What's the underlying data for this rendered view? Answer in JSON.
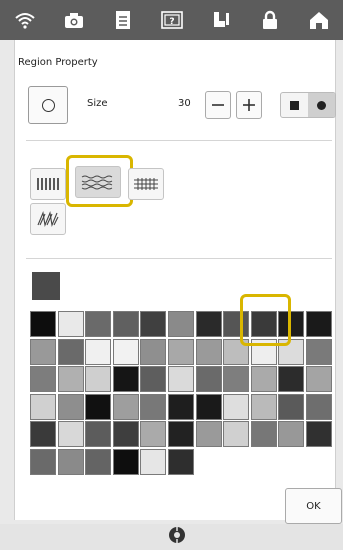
{
  "topbar": {
    "icons": [
      "wifi-icon",
      "camera-icon",
      "document-icon",
      "help-icon",
      "embroidery-foot-icon",
      "lock-icon",
      "home-icon"
    ]
  },
  "dialog": {
    "title": "Region Property",
    "shape_button_icon": "circle-outline-icon",
    "size_label": "Size",
    "size_value": "30",
    "minus_label": "−",
    "plus_label": "+",
    "style_options": [
      "square-dot-icon",
      "round-dot-icon"
    ],
    "selected_style": "round-dot-icon",
    "stitch_types": [
      "fill-stitch-icon",
      "decorative-fill-icon",
      "tatami-stitch-icon",
      "free-stitch-icon"
    ],
    "selected_stitch": "decorative-fill-icon",
    "selected_color": "#4a4a4a",
    "palette": [
      [
        "#0d0d0d",
        "#e9e9e9",
        "#6a6a6a",
        "#606060",
        "#404040",
        "#8a8a8a",
        "#2a2a2a",
        "#555555",
        "#3a3a3a",
        "#1e1e1e",
        "#1a1a1a"
      ],
      [
        "#999999",
        "#6a6a6a",
        "#f0f0f0",
        "#f2f2f2",
        "#8f8f8f",
        "#a8a8a8",
        "#9a9a9a",
        "#bdbdbd",
        "#eeeeee",
        "#dcdcdc",
        "#7a7a7a"
      ],
      [
        "#7d7d7d",
        "#b0b0b0",
        "#cfcfcf",
        "#151515",
        "#5e5e5e",
        "#dadada",
        "#6a6a6a",
        "#7e7e7e",
        "#aaaaaa",
        "#2c2c2c",
        "#a4a4a4"
      ],
      [
        "#d0d0d0",
        "#8e8e8e",
        "#111111",
        "#9e9e9e",
        "#787878",
        "#1e1e1e",
        "#1a1a1a",
        "#dedede",
        "#bababa",
        "#5a5a5a",
        "#6e6e6e"
      ],
      [
        "#3a3a3a",
        "#d8d8d8",
        "#5c5c5c",
        "#3e3e3e",
        "#aaaaaa",
        "#222222",
        "#9a9a9a",
        "#d0d0d0",
        "#777777",
        "#989898",
        "#303030"
      ],
      [
        "#6a6a6a",
        "#8a8a8a",
        "#646464",
        "#0e0e0e",
        "#e6e6e6",
        "#2e2e2e"
      ]
    ],
    "ok_label": "OK"
  },
  "bottombar": {
    "icon": "dial-icon"
  }
}
